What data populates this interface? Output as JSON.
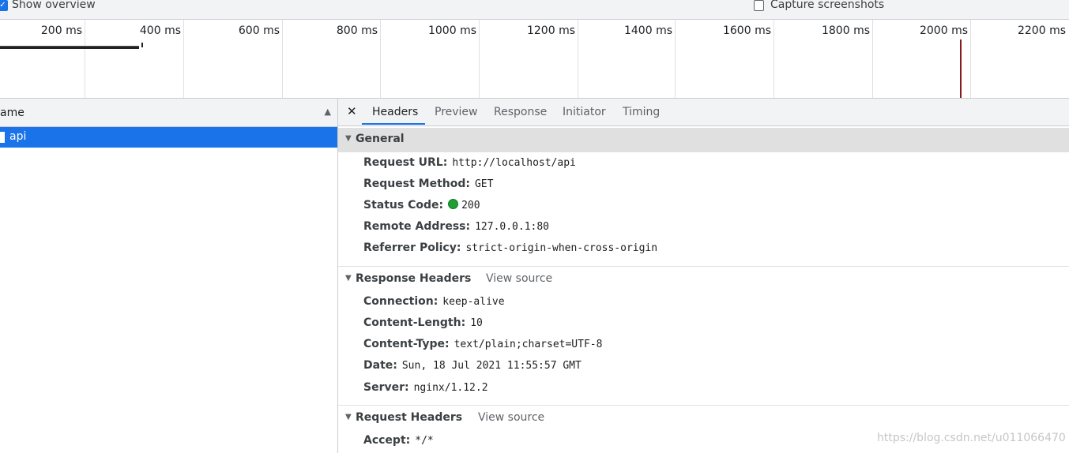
{
  "toolbar": {
    "show_overview_label": "Show overview",
    "show_overview_checked": true,
    "capture_screenshots_label": "Capture screenshots",
    "capture_screenshots_checked": false
  },
  "overview": {
    "ticks": [
      "200 ms",
      "400 ms",
      "600 ms",
      "800 ms",
      "1000 ms",
      "1200 ms",
      "1400 ms",
      "1600 ms",
      "1800 ms",
      "2000 ms",
      "2200 ms"
    ]
  },
  "request_list": {
    "column_name": "ame",
    "sort_icon": "triangle-up-icon",
    "rows": [
      {
        "name": "api",
        "selected": true
      }
    ]
  },
  "detail": {
    "close_icon": "close-icon",
    "tabs": [
      "Headers",
      "Preview",
      "Response",
      "Initiator",
      "Timing"
    ],
    "active_tab": "Headers",
    "general": {
      "title": "General",
      "rows": [
        {
          "key": "Request URL:",
          "value": "http://localhost/api"
        },
        {
          "key": "Request Method:",
          "value": "GET"
        },
        {
          "key": "Status Code:",
          "value": "200"
        },
        {
          "key": "Remote Address:",
          "value": "127.0.0.1:80"
        },
        {
          "key": "Referrer Policy:",
          "value": "strict-origin-when-cross-origin"
        }
      ]
    },
    "response_headers": {
      "title": "Response Headers",
      "view_source": "View source",
      "rows": [
        {
          "key": "Connection:",
          "value": "keep-alive"
        },
        {
          "key": "Content-Length:",
          "value": "10"
        },
        {
          "key": "Content-Type:",
          "value": "text/plain;charset=UTF-8"
        },
        {
          "key": "Date:",
          "value": "Sun, 18 Jul 2021 11:55:57 GMT"
        },
        {
          "key": "Server:",
          "value": "nginx/1.12.2"
        }
      ]
    },
    "request_headers": {
      "title": "Request Headers",
      "view_source": "View source",
      "rows": [
        {
          "key": "Accept:",
          "value": "*/*"
        }
      ]
    }
  },
  "watermark": "https://blog.csdn.net/u011066470",
  "colors": {
    "accent": "#1a73e8",
    "status_ok": "#1e9e33",
    "load_marker": "#8b1a1a"
  }
}
